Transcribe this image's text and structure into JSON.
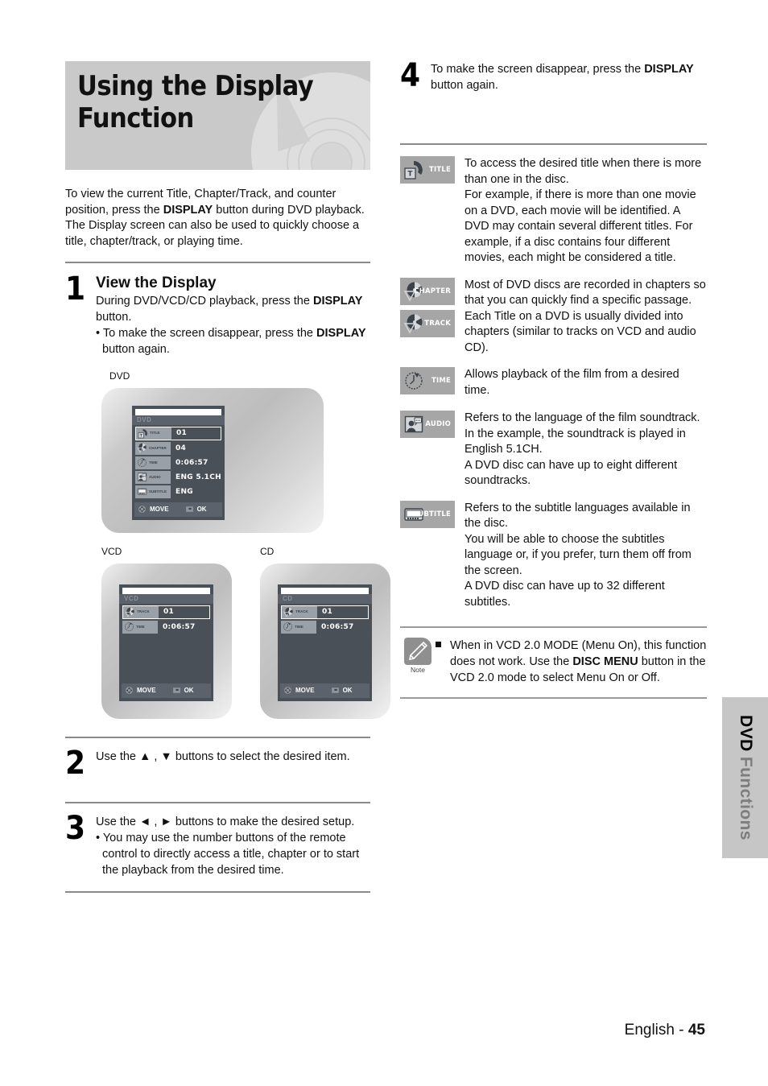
{
  "page": {
    "banner_title": "Using the Display Function",
    "footer_language": "English - ",
    "footer_page": "45",
    "side_tab_primary": "DVD ",
    "side_tab_secondary": "Functions"
  },
  "intro": {
    "part1": "To view the current Title, Chapter/Track, and counter position, press the ",
    "bold1": "DISPLAY",
    "part2": " button during DVD playback. The Display screen can also be used to quickly choose a title, chapter/track, or playing time."
  },
  "steps": [
    {
      "num": "1",
      "heading": "View the Display",
      "line1_a": "During DVD/VCD/CD playback, press the ",
      "line1_b": "DISPLAY",
      "line1_c": " button.",
      "bullet_a": "• To make the screen disappear, press the ",
      "bullet_b": "DISPLAY",
      "bullet_c": " button again."
    },
    {
      "num": "2",
      "text": "Use the ▲ , ▼ buttons to select the desired item."
    },
    {
      "num": "3",
      "line1": "Use the ◄ , ► buttons to make the desired setup.",
      "bullet": "• You may use the number buttons of the remote control to directly access a title, chapter or to start the playback from the desired time."
    },
    {
      "num": "4",
      "text_a": "To make the screen disappear, press the ",
      "text_b": "DISPLAY",
      "text_c": " button again."
    }
  ],
  "osd": {
    "dvd": {
      "caption": "DVD",
      "disc_label": "DVD",
      "rows": [
        {
          "tag": "TITLE",
          "value": "01",
          "icon": "title-disc-icon",
          "selected": true
        },
        {
          "tag": "CHAPTER",
          "value": "04",
          "icon": "chapter-disc-icon",
          "selected": false
        },
        {
          "tag": "TIME",
          "value": "0:06:57",
          "icon": "clock-icon",
          "selected": false
        },
        {
          "tag": "AUDIO",
          "value": "ENG 5.1CH",
          "icon": "audio-person-icon",
          "selected": false
        },
        {
          "tag": "SUBTITLE",
          "value": "ENG",
          "icon": "subtitle-screen-icon",
          "selected": false
        }
      ],
      "foot_move": "MOVE",
      "foot_ok": "OK"
    },
    "vcd": {
      "caption": "VCD",
      "disc_label": "VCD",
      "rows": [
        {
          "tag": "TRACK",
          "value": "01",
          "icon": "chapter-disc-icon",
          "selected": true
        },
        {
          "tag": "TIME",
          "value": "0:06:57",
          "icon": "clock-icon",
          "selected": false
        }
      ],
      "foot_move": "MOVE",
      "foot_ok": "OK"
    },
    "cd": {
      "caption": "CD",
      "disc_label": "CD",
      "rows": [
        {
          "tag": "TRACK",
          "value": "01",
          "icon": "chapter-disc-icon",
          "selected": true
        },
        {
          "tag": "TIME",
          "value": "0:06:57",
          "icon": "clock-icon",
          "selected": false
        }
      ],
      "foot_move": "MOVE",
      "foot_ok": "OK"
    }
  },
  "reference": [
    {
      "icons": [
        {
          "label": "TITLE",
          "icon": "title-disc-icon"
        }
      ],
      "text": "To access the desired title when there is more than one in the disc.\nFor example, if there is more than one movie on a DVD, each movie will be identified. A DVD may contain several different titles. For example, if a disc contains four different movies, each might be considered a title."
    },
    {
      "icons": [
        {
          "label": "CHAPTER",
          "icon": "chapter-disc-icon"
        },
        {
          "label": "TRACK",
          "icon": "chapter-disc-icon"
        }
      ],
      "text": "Most of DVD discs are recorded in chapters so that you can quickly find a specific passage.\nEach Title on a DVD is usually divided into chapters (similar to tracks on VCD and audio CD)."
    },
    {
      "icons": [
        {
          "label": "TIME",
          "icon": "clock-icon"
        }
      ],
      "text": "Allows playback of the film from a desired time."
    },
    {
      "icons": [
        {
          "label": "AUDIO",
          "icon": "audio-person-icon"
        }
      ],
      "text": "Refers to the language of the film soundtrack. In the example, the soundtrack is played in English 5.1CH.\nA DVD disc can have up to eight different soundtracks."
    },
    {
      "icons": [
        {
          "label": "SUBTITLE",
          "icon": "subtitle-screen-icon"
        }
      ],
      "text": "Refers to the subtitle languages available in the disc.\nYou will be able to choose the subtitles language or, if you prefer, turn them off from the screen.\nA DVD disc can have up to 32 different subtitles."
    }
  ],
  "note": {
    "caption": "Note",
    "text_a": "When in VCD 2.0 MODE (Menu On), this function does not work. Use the ",
    "text_b": "DISC MENU",
    "text_c": " button in the VCD 2.0 mode to select Menu On or Off."
  },
  "colors": {
    "banner_bg": "#c9c9c9",
    "osd_bg": "#4a5058",
    "osd_badge": "#9aa0a7",
    "icon_badge": "#a6a6a6",
    "rule": "#8a8a8a",
    "side_tab": "#c6c6c6"
  }
}
